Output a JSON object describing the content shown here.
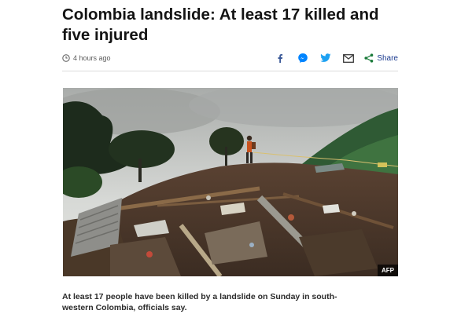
{
  "article": {
    "headline": "Colombia landslide: At least 17 killed and five injured",
    "timestamp": "4 hours ago",
    "share": {
      "label": "Share",
      "icons": [
        "facebook-icon",
        "messenger-icon",
        "twitter-icon",
        "email-icon",
        "share-icon"
      ]
    },
    "image": {
      "credit": "AFP",
      "description_icon": "landslide-photo"
    },
    "caption": "At least 17 people have been killed by a landslide on Sunday in south-western Colombia, officials say."
  },
  "colors": {
    "facebook": "#3b5998",
    "messenger": "#0084ff",
    "twitter": "#1da1f2",
    "email": "#3a3a3a",
    "share": "#1a7a3a",
    "share_text": "#1a3a8f"
  }
}
